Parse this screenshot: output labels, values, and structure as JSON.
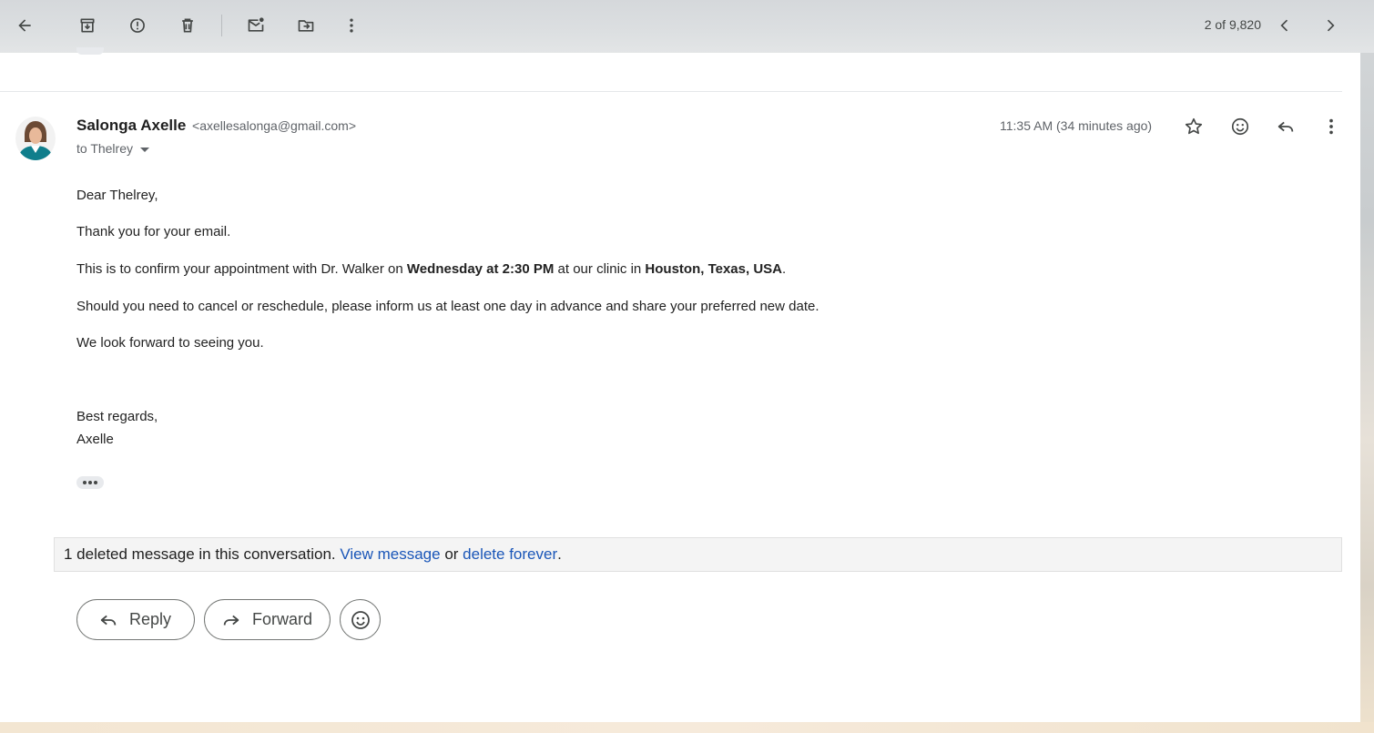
{
  "colors": {
    "link": "#1a56b8",
    "text_primary": "#202124",
    "text_secondary": "#5f6368",
    "avatar_jacket": "#0f7e8c"
  },
  "toolbar": {
    "icons": [
      "back-arrow-icon",
      "archive-icon",
      "report-spam-icon",
      "trash-icon",
      "mark-unread-icon",
      "move-to-icon",
      "more-vert-icon"
    ],
    "pager": "2 of 9,820",
    "pager_icons": [
      "chevron-left-icon",
      "chevron-right-icon"
    ]
  },
  "message": {
    "sender_name": "Salonga Axelle",
    "sender_email": "<axellesalonga@gmail.com>",
    "to_label": "to Thelrey",
    "timestamp": "11:35 AM (34 minutes ago)",
    "action_icons": [
      "star-icon",
      "emoji-icon",
      "reply-icon",
      "more-vert-icon"
    ],
    "body": {
      "greeting": "Dear Thelrey,",
      "line1": "Thank you for your email.",
      "line2_pre": "This is to confirm your appointment with Dr. Walker on ",
      "line2_bold1": "Wednesday at 2:30 PM",
      "line2_mid": " at our clinic in ",
      "line2_bold2": "Houston, Texas, USA",
      "line2_post": ".",
      "line3": "Should you need to cancel or reschedule, please inform us at least one day in advance and share your preferred new date.",
      "line4": "We look forward to seeing you.",
      "signoff": "Best regards,",
      "signature": "Axelle"
    }
  },
  "deleted_notice": {
    "prefix": "1 deleted message in this conversation. ",
    "view_link": "View message",
    "middle": " or ",
    "delete_link": "delete forever",
    "suffix": "."
  },
  "actions": {
    "reply_label": "Reply",
    "forward_label": "Forward"
  }
}
